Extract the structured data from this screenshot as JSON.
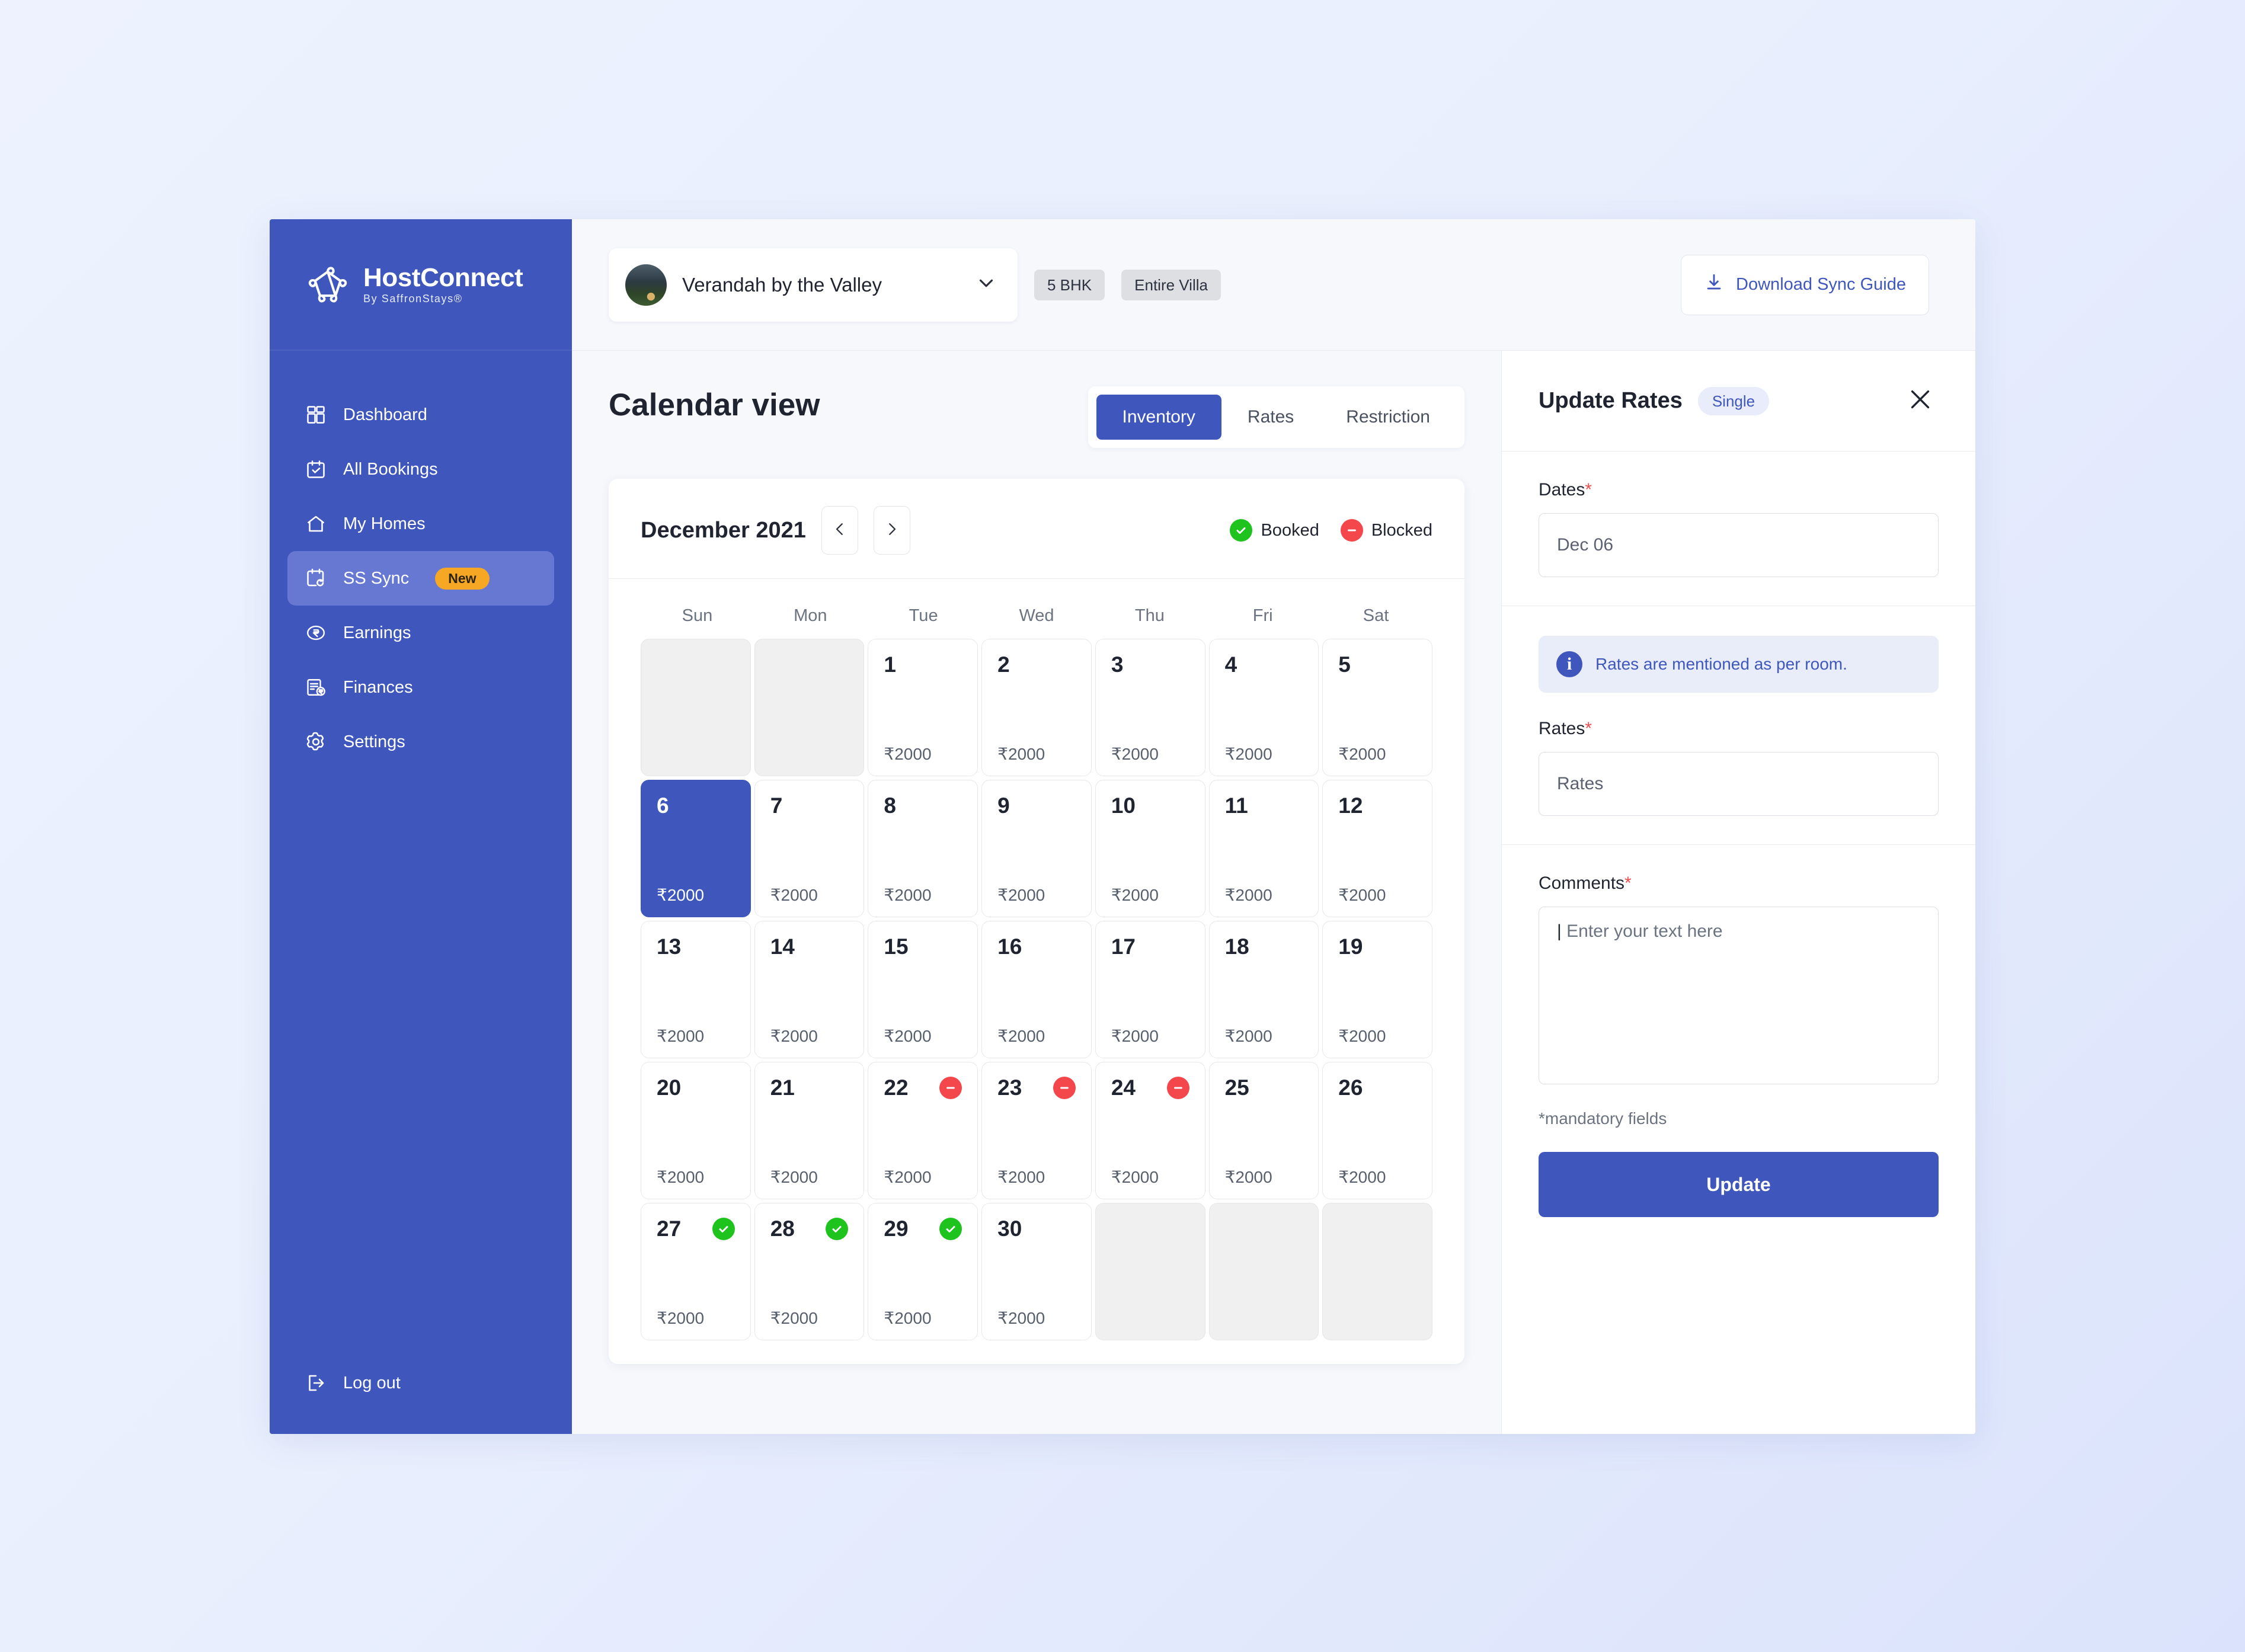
{
  "brand": {
    "title": "HostConnect",
    "subtitle": "By SaffronStays®",
    "logo_icon": "pentagon-network-icon",
    "sidebar_color": "#3f57bd"
  },
  "sidebar": {
    "items": [
      {
        "label": "Dashboard",
        "icon": "grid-dashboard-icon",
        "active": false
      },
      {
        "label": "All Bookings",
        "icon": "calendar-check-icon",
        "active": false
      },
      {
        "label": "My Homes",
        "icon": "home-icon",
        "active": false
      },
      {
        "label": "SS Sync",
        "icon": "calendar-sync-icon",
        "active": true,
        "badge": "New"
      },
      {
        "label": "Earnings",
        "icon": "rupee-circle-icon",
        "active": false
      },
      {
        "label": "Finances",
        "icon": "invoice-rupee-icon",
        "active": false
      },
      {
        "label": "Settings",
        "icon": "gear-icon",
        "active": false
      }
    ],
    "logout": {
      "label": "Log out",
      "icon": "logout-icon"
    }
  },
  "topbar": {
    "property_name": "Verandah by the Valley",
    "property_chevron": "chevron-down-icon",
    "tags": [
      "5 BHK",
      "Entire Villa"
    ],
    "download_label": "Download Sync Guide",
    "download_icon": "download-icon"
  },
  "main": {
    "page_title": "Calendar view",
    "tabs": [
      {
        "label": "Inventory",
        "active": true
      },
      {
        "label": "Rates",
        "active": false
      },
      {
        "label": "Restriction",
        "active": false
      }
    ],
    "calendar": {
      "month_label": "December 2021",
      "prev_icon": "chevron-left-icon",
      "next_icon": "chevron-right-icon",
      "legend": [
        {
          "label": "Booked",
          "color": "#1ec31e",
          "icon": "check-circle-icon"
        },
        {
          "label": "Blocked",
          "color": "#f4474b",
          "icon": "minus-circle-icon"
        }
      ],
      "weekdays": [
        "Sun",
        "Mon",
        "Tue",
        "Wed",
        "Thu",
        "Fri",
        "Sat"
      ],
      "cells": [
        {
          "day": "",
          "rate": "",
          "state": "empty"
        },
        {
          "day": "",
          "rate": "",
          "state": "empty"
        },
        {
          "day": "1",
          "rate": "₹2000",
          "state": "default"
        },
        {
          "day": "2",
          "rate": "₹2000",
          "state": "default"
        },
        {
          "day": "3",
          "rate": "₹2000",
          "state": "default"
        },
        {
          "day": "4",
          "rate": "₹2000",
          "state": "default"
        },
        {
          "day": "5",
          "rate": "₹2000",
          "state": "default"
        },
        {
          "day": "6",
          "rate": "₹2000",
          "state": "selected"
        },
        {
          "day": "7",
          "rate": "₹2000",
          "state": "default"
        },
        {
          "day": "8",
          "rate": "₹2000",
          "state": "default"
        },
        {
          "day": "9",
          "rate": "₹2000",
          "state": "default"
        },
        {
          "day": "10",
          "rate": "₹2000",
          "state": "default"
        },
        {
          "day": "11",
          "rate": "₹2000",
          "state": "default"
        },
        {
          "day": "12",
          "rate": "₹2000",
          "state": "default"
        },
        {
          "day": "13",
          "rate": "₹2000",
          "state": "default"
        },
        {
          "day": "14",
          "rate": "₹2000",
          "state": "default"
        },
        {
          "day": "15",
          "rate": "₹2000",
          "state": "default"
        },
        {
          "day": "16",
          "rate": "₹2000",
          "state": "default"
        },
        {
          "day": "17",
          "rate": "₹2000",
          "state": "default"
        },
        {
          "day": "18",
          "rate": "₹2000",
          "state": "default"
        },
        {
          "day": "19",
          "rate": "₹2000",
          "state": "default"
        },
        {
          "day": "20",
          "rate": "₹2000",
          "state": "default"
        },
        {
          "day": "21",
          "rate": "₹2000",
          "state": "default"
        },
        {
          "day": "22",
          "rate": "₹2000",
          "state": "default",
          "badge": "blocked"
        },
        {
          "day": "23",
          "rate": "₹2000",
          "state": "default",
          "badge": "blocked"
        },
        {
          "day": "24",
          "rate": "₹2000",
          "state": "default",
          "badge": "blocked"
        },
        {
          "day": "25",
          "rate": "₹2000",
          "state": "default"
        },
        {
          "day": "26",
          "rate": "₹2000",
          "state": "default"
        },
        {
          "day": "27",
          "rate": "₹2000",
          "state": "default",
          "badge": "booked"
        },
        {
          "day": "28",
          "rate": "₹2000",
          "state": "default",
          "badge": "booked"
        },
        {
          "day": "29",
          "rate": "₹2000",
          "state": "default",
          "badge": "booked"
        },
        {
          "day": "30",
          "rate": "₹2000",
          "state": "default"
        },
        {
          "day": "",
          "rate": "",
          "state": "empty"
        },
        {
          "day": "",
          "rate": "",
          "state": "empty"
        },
        {
          "day": "",
          "rate": "",
          "state": "empty"
        }
      ]
    }
  },
  "panel": {
    "title": "Update Rates",
    "mode_badge": "Single",
    "close_icon": "close-icon",
    "dates_label": "Dates",
    "dates_value": "Dec 06",
    "info_icon": "info-icon",
    "info_text": "Rates are mentioned as per room.",
    "rates_label": "Rates",
    "rates_placeholder": "Rates",
    "comments_label": "Comments",
    "comments_placeholder": "Enter your text here",
    "mandatory_note": "*mandatory fields",
    "update_label": "Update",
    "required_marker": "*"
  }
}
